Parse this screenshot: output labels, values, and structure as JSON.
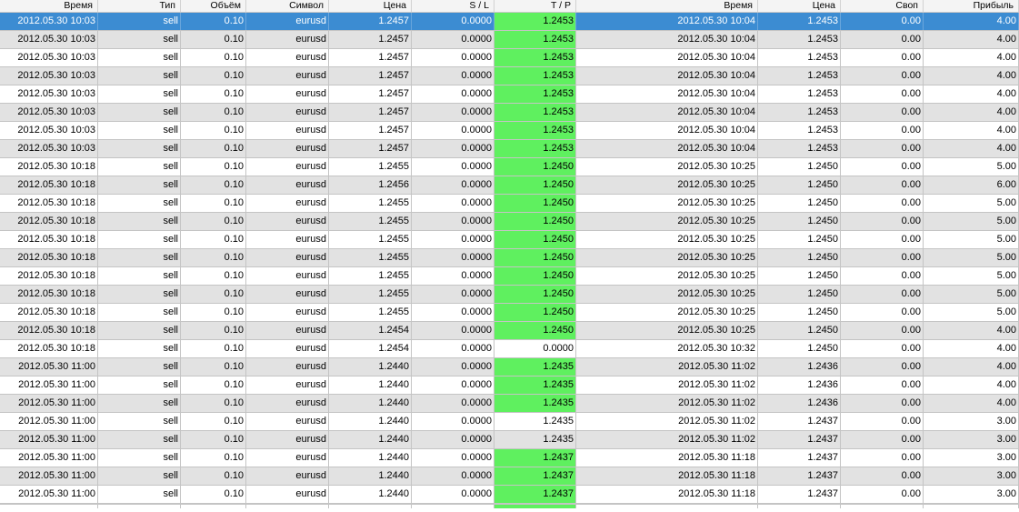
{
  "columns": [
    "Время",
    "Тип",
    "Объём",
    "Символ",
    "Цена",
    "S / L",
    "T / P",
    "Время",
    "Цена",
    "Своп",
    "Прибыль"
  ],
  "colors": {
    "tp_highlight": "#5ff05f",
    "selection": "#3c8cd2",
    "row_alt": "#e2e2e2"
  },
  "selected_row": 0,
  "rows": [
    {
      "open_time": "2012.05.30 10:03",
      "type": "sell",
      "volume": "0.10",
      "symbol": "eurusd",
      "open_price": "1.2457",
      "sl": "0.0000",
      "tp": "1.2453",
      "tp_hit": true,
      "close_time": "2012.05.30 10:04",
      "close_price": "1.2453",
      "swap": "0.00",
      "profit": "4.00"
    },
    {
      "open_time": "2012.05.30 10:03",
      "type": "sell",
      "volume": "0.10",
      "symbol": "eurusd",
      "open_price": "1.2457",
      "sl": "0.0000",
      "tp": "1.2453",
      "tp_hit": true,
      "close_time": "2012.05.30 10:04",
      "close_price": "1.2453",
      "swap": "0.00",
      "profit": "4.00"
    },
    {
      "open_time": "2012.05.30 10:03",
      "type": "sell",
      "volume": "0.10",
      "symbol": "eurusd",
      "open_price": "1.2457",
      "sl": "0.0000",
      "tp": "1.2453",
      "tp_hit": true,
      "close_time": "2012.05.30 10:04",
      "close_price": "1.2453",
      "swap": "0.00",
      "profit": "4.00"
    },
    {
      "open_time": "2012.05.30 10:03",
      "type": "sell",
      "volume": "0.10",
      "symbol": "eurusd",
      "open_price": "1.2457",
      "sl": "0.0000",
      "tp": "1.2453",
      "tp_hit": true,
      "close_time": "2012.05.30 10:04",
      "close_price": "1.2453",
      "swap": "0.00",
      "profit": "4.00"
    },
    {
      "open_time": "2012.05.30 10:03",
      "type": "sell",
      "volume": "0.10",
      "symbol": "eurusd",
      "open_price": "1.2457",
      "sl": "0.0000",
      "tp": "1.2453",
      "tp_hit": true,
      "close_time": "2012.05.30 10:04",
      "close_price": "1.2453",
      "swap": "0.00",
      "profit": "4.00"
    },
    {
      "open_time": "2012.05.30 10:03",
      "type": "sell",
      "volume": "0.10",
      "symbol": "eurusd",
      "open_price": "1.2457",
      "sl": "0.0000",
      "tp": "1.2453",
      "tp_hit": true,
      "close_time": "2012.05.30 10:04",
      "close_price": "1.2453",
      "swap": "0.00",
      "profit": "4.00"
    },
    {
      "open_time": "2012.05.30 10:03",
      "type": "sell",
      "volume": "0.10",
      "symbol": "eurusd",
      "open_price": "1.2457",
      "sl": "0.0000",
      "tp": "1.2453",
      "tp_hit": true,
      "close_time": "2012.05.30 10:04",
      "close_price": "1.2453",
      "swap": "0.00",
      "profit": "4.00"
    },
    {
      "open_time": "2012.05.30 10:03",
      "type": "sell",
      "volume": "0.10",
      "symbol": "eurusd",
      "open_price": "1.2457",
      "sl": "0.0000",
      "tp": "1.2453",
      "tp_hit": true,
      "close_time": "2012.05.30 10:04",
      "close_price": "1.2453",
      "swap": "0.00",
      "profit": "4.00"
    },
    {
      "open_time": "2012.05.30 10:18",
      "type": "sell",
      "volume": "0.10",
      "symbol": "eurusd",
      "open_price": "1.2455",
      "sl": "0.0000",
      "tp": "1.2450",
      "tp_hit": true,
      "close_time": "2012.05.30 10:25",
      "close_price": "1.2450",
      "swap": "0.00",
      "profit": "5.00"
    },
    {
      "open_time": "2012.05.30 10:18",
      "type": "sell",
      "volume": "0.10",
      "symbol": "eurusd",
      "open_price": "1.2456",
      "sl": "0.0000",
      "tp": "1.2450",
      "tp_hit": true,
      "close_time": "2012.05.30 10:25",
      "close_price": "1.2450",
      "swap": "0.00",
      "profit": "6.00"
    },
    {
      "open_time": "2012.05.30 10:18",
      "type": "sell",
      "volume": "0.10",
      "symbol": "eurusd",
      "open_price": "1.2455",
      "sl": "0.0000",
      "tp": "1.2450",
      "tp_hit": true,
      "close_time": "2012.05.30 10:25",
      "close_price": "1.2450",
      "swap": "0.00",
      "profit": "5.00"
    },
    {
      "open_time": "2012.05.30 10:18",
      "type": "sell",
      "volume": "0.10",
      "symbol": "eurusd",
      "open_price": "1.2455",
      "sl": "0.0000",
      "tp": "1.2450",
      "tp_hit": true,
      "close_time": "2012.05.30 10:25",
      "close_price": "1.2450",
      "swap": "0.00",
      "profit": "5.00"
    },
    {
      "open_time": "2012.05.30 10:18",
      "type": "sell",
      "volume": "0.10",
      "symbol": "eurusd",
      "open_price": "1.2455",
      "sl": "0.0000",
      "tp": "1.2450",
      "tp_hit": true,
      "close_time": "2012.05.30 10:25",
      "close_price": "1.2450",
      "swap": "0.00",
      "profit": "5.00"
    },
    {
      "open_time": "2012.05.30 10:18",
      "type": "sell",
      "volume": "0.10",
      "symbol": "eurusd",
      "open_price": "1.2455",
      "sl": "0.0000",
      "tp": "1.2450",
      "tp_hit": true,
      "close_time": "2012.05.30 10:25",
      "close_price": "1.2450",
      "swap": "0.00",
      "profit": "5.00"
    },
    {
      "open_time": "2012.05.30 10:18",
      "type": "sell",
      "volume": "0.10",
      "symbol": "eurusd",
      "open_price": "1.2455",
      "sl": "0.0000",
      "tp": "1.2450",
      "tp_hit": true,
      "close_time": "2012.05.30 10:25",
      "close_price": "1.2450",
      "swap": "0.00",
      "profit": "5.00"
    },
    {
      "open_time": "2012.05.30 10:18",
      "type": "sell",
      "volume": "0.10",
      "symbol": "eurusd",
      "open_price": "1.2455",
      "sl": "0.0000",
      "tp": "1.2450",
      "tp_hit": true,
      "close_time": "2012.05.30 10:25",
      "close_price": "1.2450",
      "swap": "0.00",
      "profit": "5.00"
    },
    {
      "open_time": "2012.05.30 10:18",
      "type": "sell",
      "volume": "0.10",
      "symbol": "eurusd",
      "open_price": "1.2455",
      "sl": "0.0000",
      "tp": "1.2450",
      "tp_hit": true,
      "close_time": "2012.05.30 10:25",
      "close_price": "1.2450",
      "swap": "0.00",
      "profit": "5.00"
    },
    {
      "open_time": "2012.05.30 10:18",
      "type": "sell",
      "volume": "0.10",
      "symbol": "eurusd",
      "open_price": "1.2454",
      "sl": "0.0000",
      "tp": "1.2450",
      "tp_hit": true,
      "close_time": "2012.05.30 10:25",
      "close_price": "1.2450",
      "swap": "0.00",
      "profit": "4.00"
    },
    {
      "open_time": "2012.05.30 10:18",
      "type": "sell",
      "volume": "0.10",
      "symbol": "eurusd",
      "open_price": "1.2454",
      "sl": "0.0000",
      "tp": "0.0000",
      "tp_hit": false,
      "close_time": "2012.05.30 10:32",
      "close_price": "1.2450",
      "swap": "0.00",
      "profit": "4.00"
    },
    {
      "open_time": "2012.05.30 11:00",
      "type": "sell",
      "volume": "0.10",
      "symbol": "eurusd",
      "open_price": "1.2440",
      "sl": "0.0000",
      "tp": "1.2435",
      "tp_hit": true,
      "close_time": "2012.05.30 11:02",
      "close_price": "1.2436",
      "swap": "0.00",
      "profit": "4.00"
    },
    {
      "open_time": "2012.05.30 11:00",
      "type": "sell",
      "volume": "0.10",
      "symbol": "eurusd",
      "open_price": "1.2440",
      "sl": "0.0000",
      "tp": "1.2435",
      "tp_hit": true,
      "close_time": "2012.05.30 11:02",
      "close_price": "1.2436",
      "swap": "0.00",
      "profit": "4.00"
    },
    {
      "open_time": "2012.05.30 11:00",
      "type": "sell",
      "volume": "0.10",
      "symbol": "eurusd",
      "open_price": "1.2440",
      "sl": "0.0000",
      "tp": "1.2435",
      "tp_hit": true,
      "close_time": "2012.05.30 11:02",
      "close_price": "1.2436",
      "swap": "0.00",
      "profit": "4.00"
    },
    {
      "open_time": "2012.05.30 11:00",
      "type": "sell",
      "volume": "0.10",
      "symbol": "eurusd",
      "open_price": "1.2440",
      "sl": "0.0000",
      "tp": "1.2435",
      "tp_hit": false,
      "close_time": "2012.05.30 11:02",
      "close_price": "1.2437",
      "swap": "0.00",
      "profit": "3.00"
    },
    {
      "open_time": "2012.05.30 11:00",
      "type": "sell",
      "volume": "0.10",
      "symbol": "eurusd",
      "open_price": "1.2440",
      "sl": "0.0000",
      "tp": "1.2435",
      "tp_hit": false,
      "close_time": "2012.05.30 11:02",
      "close_price": "1.2437",
      "swap": "0.00",
      "profit": "3.00"
    },
    {
      "open_time": "2012.05.30 11:00",
      "type": "sell",
      "volume": "0.10",
      "symbol": "eurusd",
      "open_price": "1.2440",
      "sl": "0.0000",
      "tp": "1.2437",
      "tp_hit": true,
      "close_time": "2012.05.30 11:18",
      "close_price": "1.2437",
      "swap": "0.00",
      "profit": "3.00"
    },
    {
      "open_time": "2012.05.30 11:00",
      "type": "sell",
      "volume": "0.10",
      "symbol": "eurusd",
      "open_price": "1.2440",
      "sl": "0.0000",
      "tp": "1.2437",
      "tp_hit": true,
      "close_time": "2012.05.30 11:18",
      "close_price": "1.2437",
      "swap": "0.00",
      "profit": "3.00"
    },
    {
      "open_time": "2012.05.30 11:00",
      "type": "sell",
      "volume": "0.10",
      "symbol": "eurusd",
      "open_price": "1.2440",
      "sl": "0.0000",
      "tp": "1.2437",
      "tp_hit": true,
      "close_time": "2012.05.30 11:18",
      "close_price": "1.2437",
      "swap": "0.00",
      "profit": "3.00"
    }
  ]
}
